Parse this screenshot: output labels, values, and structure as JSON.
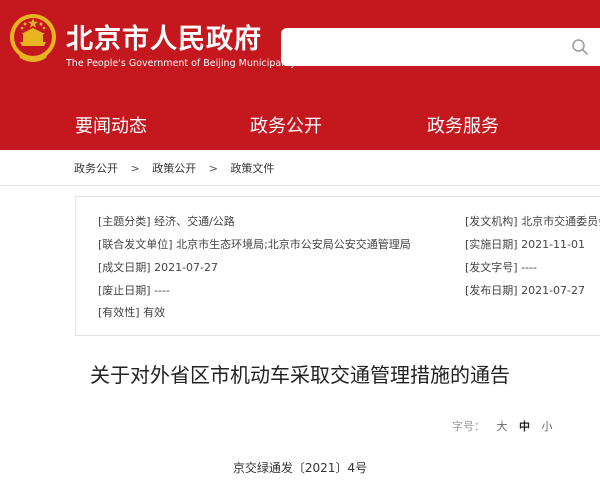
{
  "header": {
    "title": "北京市人民政府",
    "subtitle": "The People's Government of Beijing Municipality",
    "emblem_icon": "national-emblem-icon",
    "bg_color": "#c4171e"
  },
  "search": {
    "placeholder": "",
    "icon": "search-icon"
  },
  "nav": {
    "items": [
      {
        "label": "要闻动态"
      },
      {
        "label": "政务公开"
      },
      {
        "label": "政务服务"
      }
    ]
  },
  "breadcrumb": {
    "items": [
      "政务公开",
      "政策公开",
      "政策文件"
    ],
    "separator": ">"
  },
  "meta": {
    "subject": {
      "key": "[主题分类]",
      "value": "经济、交通/公路"
    },
    "joint_issuer": {
      "key": "[联合发文单位]",
      "value": "北京市生态环境局;北京市公安局公安交通管理局"
    },
    "written_date": {
      "key": "[成文日期]",
      "value": "2021-07-27"
    },
    "repeal_date": {
      "key": "[废止日期]",
      "value": "----"
    },
    "validity": {
      "key": "[有效性]",
      "value": "有效"
    },
    "issuing_org": {
      "key": "[发文机构]",
      "value": "北京市交通委员会"
    },
    "effective_date": {
      "key": "[实施日期]",
      "value": "2021-11-01"
    },
    "doc_number": {
      "key": "[发文字号]",
      "value": "----"
    },
    "publish_date": {
      "key": "[发布日期]",
      "value": "2021-07-27"
    }
  },
  "article": {
    "title": "关于对外省区市机动车采取交通管理措施的通告",
    "doc_no": "京交绿通发〔2021〕4号"
  },
  "font_size": {
    "label": "字号：",
    "options": [
      "大",
      "中",
      "小"
    ],
    "selected": "中"
  }
}
